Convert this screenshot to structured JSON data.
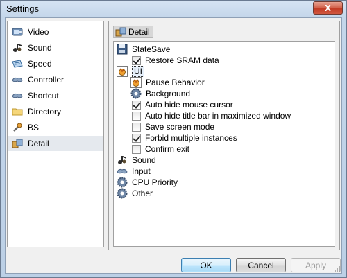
{
  "window": {
    "title": "Settings",
    "close_glyph": "X"
  },
  "nav": {
    "items": [
      {
        "label": "Video",
        "icon": "video-icon"
      },
      {
        "label": "Sound",
        "icon": "sound-icon"
      },
      {
        "label": "Speed",
        "icon": "speed-icon"
      },
      {
        "label": "Controller",
        "icon": "controller-icon"
      },
      {
        "label": "Shortcut",
        "icon": "shortcut-icon"
      },
      {
        "label": "Directory",
        "icon": "folder-icon"
      },
      {
        "label": "BS",
        "icon": "bs-icon"
      },
      {
        "label": "Detail",
        "icon": "detail-icon"
      }
    ],
    "selected": "Detail"
  },
  "panel": {
    "header": "Detail"
  },
  "tree": {
    "statesave": {
      "label": "StateSave",
      "restore_sram": {
        "label": "Restore SRAM data",
        "checked": true
      }
    },
    "ui": {
      "label": "UI",
      "pause_behavior": "Pause Behavior",
      "background": "Background",
      "auto_hide_cursor": {
        "label": "Auto hide mouse cursor",
        "checked": true
      },
      "auto_hide_titlebar": {
        "label": "Auto hide title bar in maximized window",
        "checked": false
      },
      "save_screen_mode": {
        "label": "Save screen mode",
        "checked": false
      },
      "forbid_multiple": {
        "label": "Forbid multiple instances",
        "checked": true
      },
      "confirm_exit": {
        "label": "Confirm exit",
        "checked": false
      }
    },
    "sound": "Sound",
    "input": "Input",
    "cpu_priority": "CPU Priority",
    "other": "Other"
  },
  "buttons": {
    "ok": "OK",
    "cancel": "Cancel",
    "apply": "Apply"
  },
  "colors": {
    "selection": "#e5e9ee",
    "close": "#c23b24",
    "ok_border": "#3c7fb1"
  }
}
